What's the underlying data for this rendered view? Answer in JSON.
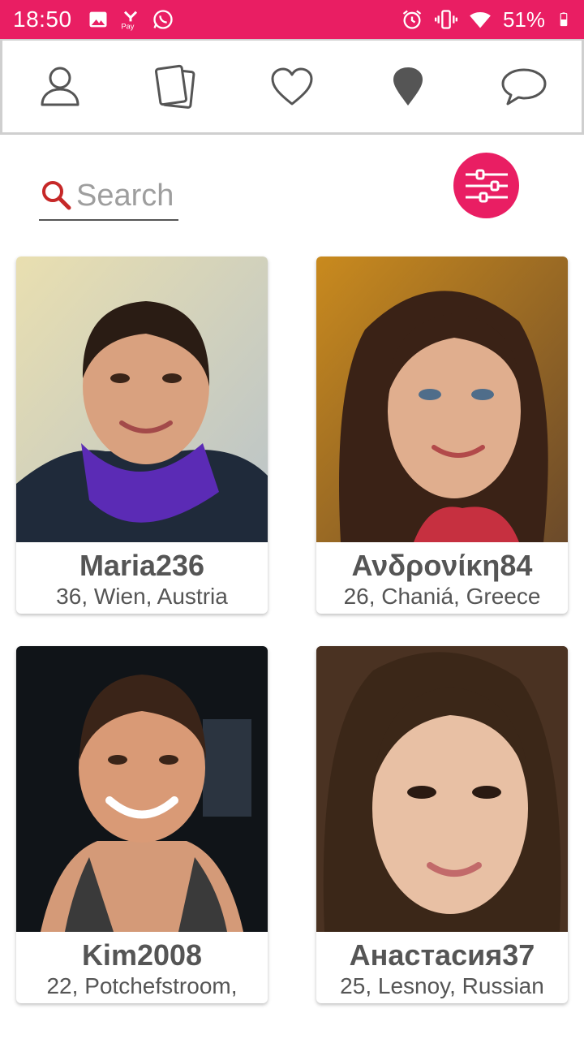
{
  "status_bar": {
    "time": "18:50",
    "battery": "51%",
    "icons_left": [
      "image-icon",
      "pay-icon",
      "whatsapp-icon"
    ],
    "icons_right": [
      "alarm-icon",
      "vibrate-icon",
      "wifi-icon",
      "battery-icon"
    ]
  },
  "nav": {
    "items": [
      {
        "icon": "profile-icon"
      },
      {
        "icon": "cards-icon"
      },
      {
        "icon": "heart-icon"
      },
      {
        "icon": "location-pin-icon"
      },
      {
        "icon": "chat-bubble-icon"
      }
    ]
  },
  "search": {
    "placeholder": "Search",
    "value": ""
  },
  "colors": {
    "accent": "#e91e63",
    "search_icon": "#c62828",
    "text": "#555555"
  },
  "profiles": [
    {
      "name": "Maria236",
      "meta": "36, Wien, Austria"
    },
    {
      "name": "Ανδρονίκη84",
      "meta": "26, Chaniá, Greece"
    },
    {
      "name": "Kim2008",
      "meta": "22, Potchefstroom,"
    },
    {
      "name": "Анастасия37",
      "meta": "25, Lesnoy, Russian"
    }
  ]
}
